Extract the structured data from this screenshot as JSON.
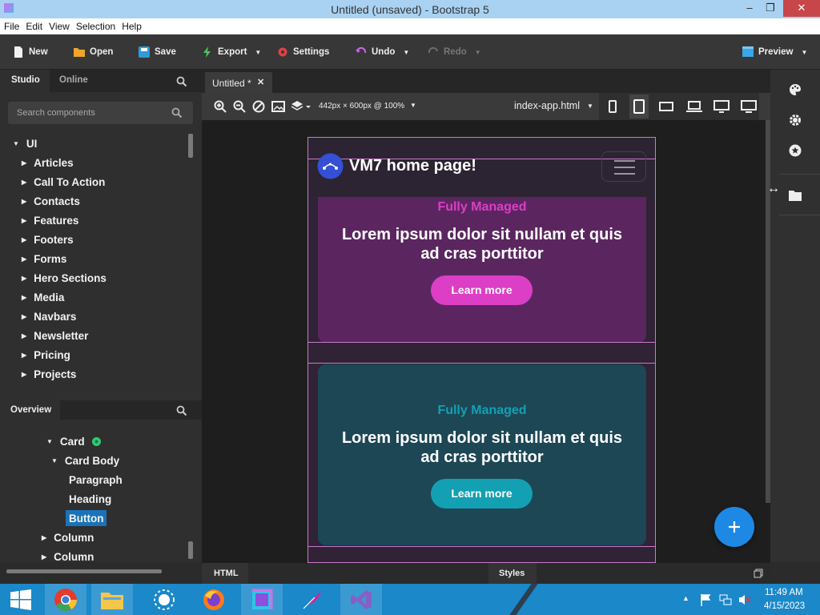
{
  "window": {
    "title": "Untitled (unsaved) - Bootstrap 5",
    "minimize": "–",
    "maximize": "❐",
    "close": "✕"
  },
  "menu": [
    "File",
    "Edit",
    "View",
    "Selection",
    "Help"
  ],
  "toolbar": {
    "new": "New",
    "open": "Open",
    "save": "Save",
    "export": "Export",
    "settings": "Settings",
    "undo": "Undo",
    "redo": "Redo",
    "preview": "Preview"
  },
  "left_panel": {
    "tabs": [
      "Studio",
      "Online"
    ],
    "search_placeholder": "Search components",
    "tree_root": "UI",
    "components": [
      "Articles",
      "Call To Action",
      "Contacts",
      "Features",
      "Footers",
      "Forms",
      "Hero Sections",
      "Media",
      "Navbars",
      "Newsletter",
      "Pricing",
      "Projects"
    ]
  },
  "overview": {
    "title": "Overview",
    "nodes": [
      "Card",
      "Card Body",
      "Paragraph",
      "Heading",
      "Button",
      "Column",
      "Column"
    ],
    "selected": "Button"
  },
  "editor": {
    "tab": "Untitled *",
    "viewport": "442px × 600px @ 100%",
    "file": "index-app.html"
  },
  "preview": {
    "brand": "VM7 home page!",
    "cards": [
      {
        "eyebrow": "Fully Managed",
        "heading": "Lorem ipsum dolor sit nullam et quis ad cras porttitor",
        "button": "Learn more",
        "bg": "#5b2660",
        "accent": "#dc3fc6"
      },
      {
        "eyebrow": "Fully Managed",
        "heading": "Lorem ipsum dolor sit nullam et quis ad cras porttitor",
        "button": "Learn more",
        "bg": "#1d4755",
        "accent": "#14a0b3"
      }
    ]
  },
  "bottom": {
    "left": "HTML",
    "right": "Styles"
  },
  "taskbar": {
    "time": "11:49 AM",
    "date": "4/15/2023"
  },
  "colors": {
    "accent": "#1a88c9",
    "fab": "#1e88e5",
    "selection": "#1a73b8"
  }
}
